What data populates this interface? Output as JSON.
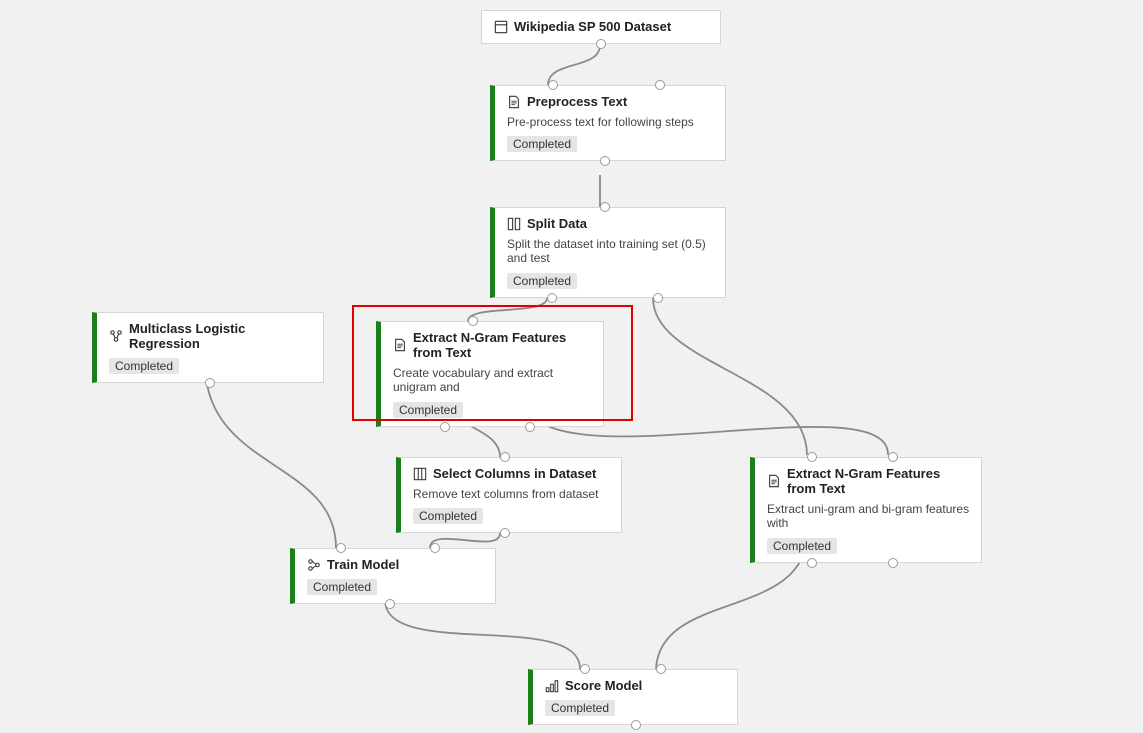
{
  "nodes": {
    "dataset": {
      "title": "Wikipedia SP 500 Dataset"
    },
    "preprocess": {
      "title": "Preprocess Text",
      "desc": "Pre-process text for following steps",
      "status": "Completed"
    },
    "split": {
      "title": "Split Data",
      "desc": "Split the dataset into training set (0.5) and test",
      "status": "Completed"
    },
    "logreg": {
      "title": "Multiclass Logistic Regression",
      "status": "Completed"
    },
    "ngram1": {
      "title": "Extract N-Gram Features from Text",
      "desc": "Create vocabulary and extract unigram and",
      "status": "Completed"
    },
    "select": {
      "title": "Select Columns in Dataset",
      "desc": "Remove text columns from dataset",
      "status": "Completed"
    },
    "ngram2": {
      "title": "Extract N-Gram Features from Text",
      "desc": "Extract uni-gram and bi-gram features with",
      "status": "Completed"
    },
    "train": {
      "title": "Train Model",
      "status": "Completed"
    },
    "score": {
      "title": "Score Model",
      "status": "Completed"
    }
  }
}
